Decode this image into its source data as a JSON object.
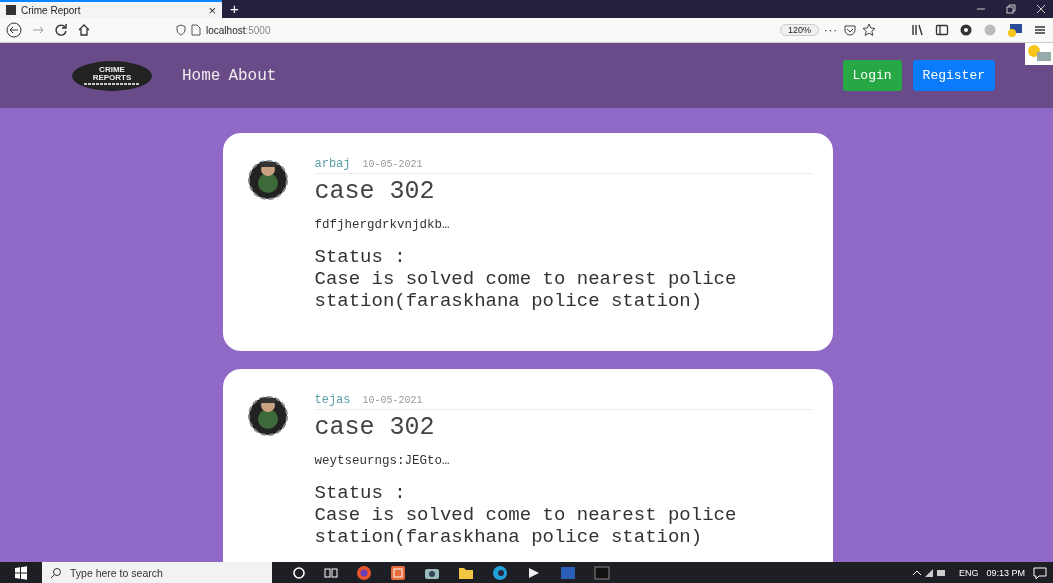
{
  "browser": {
    "tab_title": "Crime Report",
    "tab_close": "×",
    "new_tab": "+",
    "url_host": "localhost",
    "url_port": ":5000",
    "zoom": "120%",
    "more": "···"
  },
  "navbar": {
    "logo_title": "CRIME REPORTS",
    "links": [
      "Home",
      "About"
    ],
    "buttons": [
      {
        "label": "Login",
        "kind": "success"
      },
      {
        "label": "Register",
        "kind": "primary"
      }
    ]
  },
  "posts": [
    {
      "author": "arbaj",
      "date": "10-05-2021",
      "title": "case 302",
      "excerpt": "fdfjhergdrkvnjdkb…",
      "status_label": "Status :",
      "status_text": "Case is solved come to nearest police station(faraskhana police station)"
    },
    {
      "author": "tejas",
      "date": "10-05-2021",
      "title": "case 302",
      "excerpt": "weytseurngs:JEGto…",
      "status_label": "Status :",
      "status_text": "Case is solved come to nearest police station(faraskhana police station)"
    }
  ],
  "taskbar": {
    "search_placeholder": "Type here to search",
    "language": "ENG",
    "time": "09:13 PM"
  }
}
